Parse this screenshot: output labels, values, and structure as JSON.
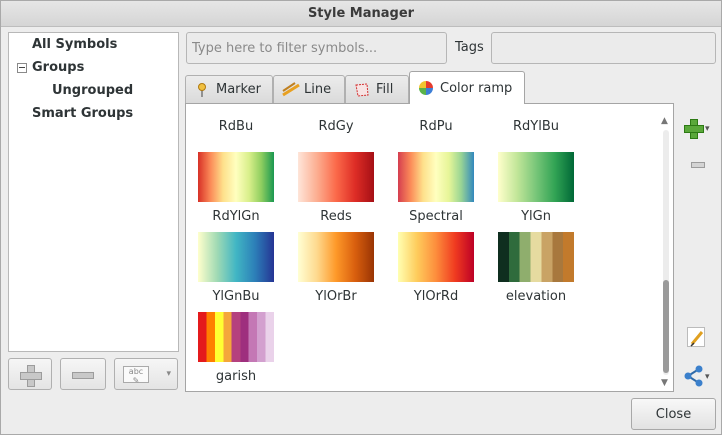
{
  "window": {
    "title": "Style Manager"
  },
  "tree": {
    "items": [
      {
        "label": "All Symbols"
      },
      {
        "label": "Groups"
      },
      {
        "label": "Ungrouped"
      },
      {
        "label": "Smart Groups"
      }
    ]
  },
  "tree_buttons": {
    "add_icon": "plus-icon",
    "remove_icon": "minus-icon",
    "rename_icon": "abc-rename-icon"
  },
  "filter": {
    "placeholder": "Type here to filter symbols...",
    "value": ""
  },
  "tags": {
    "label": "Tags",
    "value": ""
  },
  "tabs": [
    {
      "label": "Marker",
      "icon": "marker-icon",
      "active": false
    },
    {
      "label": "Line",
      "icon": "line-icon",
      "active": false
    },
    {
      "label": "Fill",
      "icon": "fill-icon",
      "active": false
    },
    {
      "label": "Color ramp",
      "icon": "color-wheel-icon",
      "active": true
    }
  ],
  "ramps_top_row": [
    {
      "name": "RdBu",
      "colors": [
        "#b2182b",
        "#ef8a62",
        "#fddbc7",
        "#f7f7f7",
        "#d1e5f0",
        "#67a9cf",
        "#2166ac"
      ]
    },
    {
      "name": "RdGy",
      "colors": [
        "#b2182b",
        "#ef8a62",
        "#fddbc7",
        "#ffffff",
        "#e0e0e0",
        "#999999",
        "#4d4d4d"
      ]
    },
    {
      "name": "RdPu",
      "colors": [
        "#fde0dd",
        "#fa9fb5",
        "#f768a1",
        "#c51b8a",
        "#7a0177"
      ]
    },
    {
      "name": "RdYlBu",
      "colors": [
        "#d73027",
        "#fc8d59",
        "#fee090",
        "#ffffbf",
        "#e0f3f8",
        "#91bfdb",
        "#4575b4"
      ]
    }
  ],
  "ramps": [
    {
      "name": "RdYlGn",
      "colors": [
        "#d73027",
        "#fc8d59",
        "#fee08b",
        "#ffffbf",
        "#d9ef8b",
        "#91cf60",
        "#1a9850"
      ]
    },
    {
      "name": "Reds",
      "colors": [
        "#fee5d9",
        "#fcae91",
        "#fb6a4a",
        "#de2d26",
        "#a50f15"
      ]
    },
    {
      "name": "Spectral",
      "colors": [
        "#d53e4f",
        "#fc8d59",
        "#fee08b",
        "#ffffbf",
        "#e6f598",
        "#99d594",
        "#3288bd"
      ]
    },
    {
      "name": "YlGn",
      "colors": [
        "#ffffcc",
        "#c2e699",
        "#78c679",
        "#31a354",
        "#006837"
      ]
    },
    {
      "name": "YlGnBu",
      "colors": [
        "#ffffcc",
        "#a1dab4",
        "#41b6c4",
        "#2c7fb8",
        "#253494"
      ]
    },
    {
      "name": "YlOrBr",
      "colors": [
        "#ffffd4",
        "#fed98e",
        "#fe9929",
        "#d95f0e",
        "#993404"
      ]
    },
    {
      "name": "YlOrRd",
      "colors": [
        "#ffffb2",
        "#fecc5c",
        "#fd8d3c",
        "#f03b20",
        "#bd0026"
      ]
    },
    {
      "name": "elevation",
      "colors": [
        "#0f2e1f",
        "#2f6b3c",
        "#8fae6d",
        "#e6dba0",
        "#c9a365",
        "#a8783d",
        "#c27a2c"
      ]
    },
    {
      "name": "garish",
      "colors": [
        "#e41a1c",
        "#ff7f00",
        "#ffff33",
        "#f4a73b",
        "#b5417e",
        "#9e2f7e",
        "#c478b5",
        "#d3a0cf",
        "#ead2ea"
      ]
    }
  ],
  "side_actions": {
    "add_icon": "green-plus-icon",
    "remove_icon": "minus-icon",
    "edit_icon": "edit-icon",
    "share_icon": "share-icon"
  },
  "close_button": {
    "label": "Close"
  },
  "colors": {
    "accent": "#5aa83a",
    "window_bg": "#ededed"
  }
}
